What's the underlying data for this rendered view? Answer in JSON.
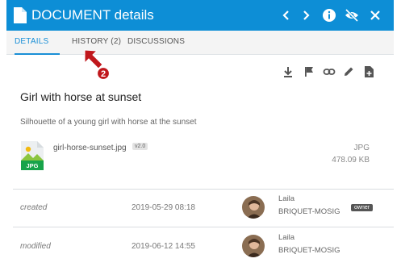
{
  "header": {
    "title": "DOCUMENT details",
    "buttons": [
      "chevron-left",
      "chevron-right",
      "info",
      "eye-off",
      "close"
    ]
  },
  "tabs": [
    {
      "label": "DETAILS",
      "active": true
    },
    {
      "label": "HISTORY (2)",
      "active": false
    },
    {
      "label": "DISCUSSIONS",
      "active": false
    }
  ],
  "toolbar": [
    "download-icon",
    "flag-icon",
    "link-icon",
    "edit-icon",
    "file-add-icon"
  ],
  "document": {
    "title": "Girl with horse at sunset",
    "description": "Silhouette of a young girl with horse at the sunset"
  },
  "file": {
    "thumb_label": "JPG",
    "name": "girl-horse-sunset.jpg",
    "version": "v2.0",
    "type": "JPG",
    "size": "478.09 KB"
  },
  "history": [
    {
      "label": "created",
      "date": "2019-05-29 08:18",
      "user_first": "Laila",
      "user_last": "BRIQUET-MOSIG",
      "badge": "owner"
    },
    {
      "label": "modified",
      "date": "2019-06-12 14:55",
      "user_first": "Laila",
      "user_last": "BRIQUET-MOSIG",
      "badge": ""
    }
  ],
  "annotation": {
    "number": "2"
  },
  "colors": {
    "header": "#0d8ed6",
    "accent": "#1a8fd6",
    "arrow": "#c0171c"
  }
}
